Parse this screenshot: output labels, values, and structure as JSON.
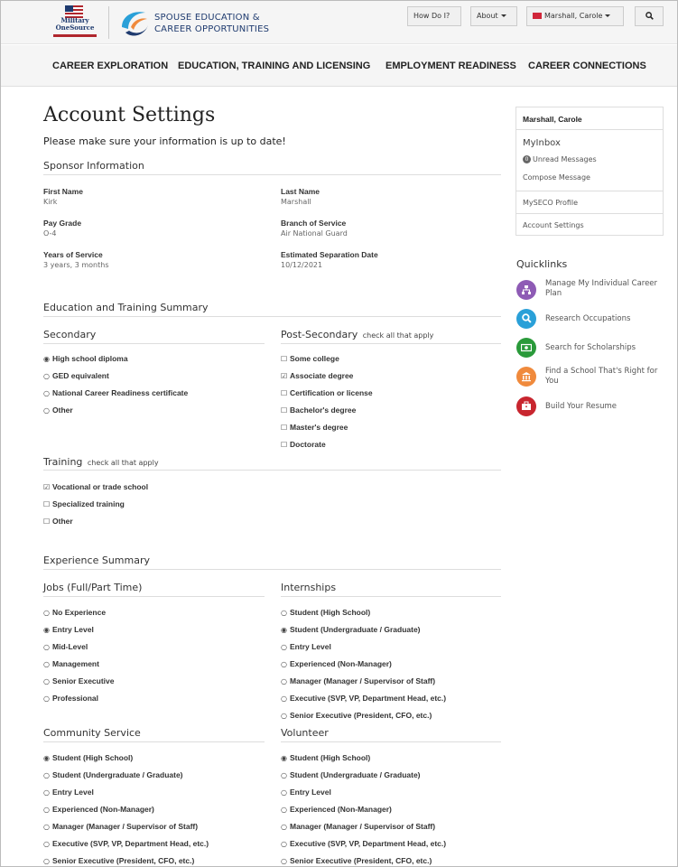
{
  "header": {
    "mos_logo_text": "Military OneSource",
    "seco_logo_line1": "SPOUSE EDUCATION &",
    "seco_logo_line2": "CAREER OPPORTUNITIES",
    "how_do_label": "How Do I?",
    "about_label": "About",
    "user_label": "Marshall, Carole",
    "search_icon": "search-icon"
  },
  "mainnav": [
    "CAREER EXPLORATION",
    "EDUCATION, TRAINING AND LICENSING",
    "EMPLOYMENT READINESS",
    "CAREER CONNECTIONS"
  ],
  "page": {
    "title": "Account Settings",
    "subtitle": "Please make sure your information is up to date!"
  },
  "sponsor": {
    "heading": "Sponsor Information",
    "fields": [
      {
        "label": "First Name",
        "value": "Kirk"
      },
      {
        "label": "Last Name",
        "value": "Marshall"
      },
      {
        "label": "Pay Grade",
        "value": "O-4"
      },
      {
        "label": "Branch of Service",
        "value": "Air National Guard"
      },
      {
        "label": "Years of Service",
        "value": "3 years, 3 months"
      },
      {
        "label": "Estimated Separation Date",
        "value": "10/12/2021"
      }
    ]
  },
  "education": {
    "heading": "Education and Training Summary",
    "secondary": {
      "heading": "Secondary",
      "options": [
        {
          "label": "High school diploma",
          "checked": true
        },
        {
          "label": "GED equivalent",
          "checked": false
        },
        {
          "label": "National Career Readiness certificate",
          "checked": false
        },
        {
          "label": "Other",
          "checked": false
        }
      ]
    },
    "post_secondary": {
      "heading": "Post-Secondary",
      "note": "check all that apply",
      "options": [
        {
          "label": "Some college",
          "checked": false
        },
        {
          "label": "Associate degree",
          "checked": true
        },
        {
          "label": "Certification or license",
          "checked": false
        },
        {
          "label": "Bachelor's degree",
          "checked": false
        },
        {
          "label": "Master's degree",
          "checked": false
        },
        {
          "label": "Doctorate",
          "checked": false
        }
      ]
    },
    "training": {
      "heading": "Training",
      "note": "check all that apply",
      "options": [
        {
          "label": "Vocational or trade school",
          "checked": true
        },
        {
          "label": "Specialized training",
          "checked": false
        },
        {
          "label": "Other",
          "checked": false
        }
      ]
    }
  },
  "experience": {
    "heading": "Experience Summary",
    "jobs": {
      "heading": "Jobs (Full/Part Time)",
      "options": [
        {
          "label": "No Experience",
          "checked": false
        },
        {
          "label": "Entry Level",
          "checked": true
        },
        {
          "label": "Mid-Level",
          "checked": false
        },
        {
          "label": "Management",
          "checked": false
        },
        {
          "label": "Senior Executive",
          "checked": false
        },
        {
          "label": "Professional",
          "checked": false
        }
      ]
    },
    "internships": {
      "heading": "Internships",
      "options": [
        {
          "label": "Student (High School)",
          "checked": false
        },
        {
          "label": "Student (Undergraduate / Graduate)",
          "checked": true
        },
        {
          "label": "Entry Level",
          "checked": false
        },
        {
          "label": "Experienced (Non-Manager)",
          "checked": false
        },
        {
          "label": "Manager (Manager / Supervisor of Staff)",
          "checked": false
        },
        {
          "label": "Executive (SVP, VP, Department Head, etc.)",
          "checked": false
        },
        {
          "label": "Senior Executive (President, CFO, etc.)",
          "checked": false
        }
      ]
    },
    "community": {
      "heading": "Community Service",
      "options": [
        {
          "label": "Student (High School)",
          "checked": true
        },
        {
          "label": "Student (Undergraduate / Graduate)",
          "checked": false
        },
        {
          "label": "Entry Level",
          "checked": false
        },
        {
          "label": "Experienced (Non-Manager)",
          "checked": false
        },
        {
          "label": "Manager (Manager / Supervisor of Staff)",
          "checked": false
        },
        {
          "label": "Executive (SVP, VP, Department Head, etc.)",
          "checked": false
        },
        {
          "label": "Senior Executive (President, CFO, etc.)",
          "checked": false
        }
      ]
    },
    "volunteer": {
      "heading": "Volunteer",
      "options": [
        {
          "label": "Student (High School)",
          "checked": true
        },
        {
          "label": "Student (Undergraduate / Graduate)",
          "checked": false
        },
        {
          "label": "Entry Level",
          "checked": false
        },
        {
          "label": "Experienced (Non-Manager)",
          "checked": false
        },
        {
          "label": "Manager (Manager / Supervisor of Staff)",
          "checked": false
        },
        {
          "label": "Executive (SVP, VP, Department Head, etc.)",
          "checked": false
        },
        {
          "label": "Senior Executive (President, CFO, etc.)",
          "checked": false
        }
      ]
    }
  },
  "sidebar": {
    "name": "Marshall, Carole",
    "inbox_label": "MyInbox",
    "unread_count": "0",
    "unread_label": "Unread Messages",
    "compose_label": "Compose Message",
    "profile_label": "MySECO Profile",
    "settings_label": "Account Settings"
  },
  "quicklinks": {
    "title": "Quicklinks",
    "items": [
      {
        "label": "Manage My Individual Career Plan",
        "icon": "sitemap-icon",
        "color": "#8e5bb5"
      },
      {
        "label": "Research Occupations",
        "icon": "search-icon",
        "color": "#2aa0d8"
      },
      {
        "label": "Search for Scholarships",
        "icon": "money-icon",
        "color": "#2a9a3a"
      },
      {
        "label": "Find a School That's Right for You",
        "icon": "school-icon",
        "color": "#f08a3c"
      },
      {
        "label": "Build Your Resume",
        "icon": "briefcase-icon",
        "color": "#c8262f"
      }
    ]
  },
  "colors": {
    "brand_navy": "#1f3b6f",
    "brand_red": "#b0262d",
    "seco_orange": "#f08a3c",
    "seco_blue": "#2aa0d8"
  }
}
